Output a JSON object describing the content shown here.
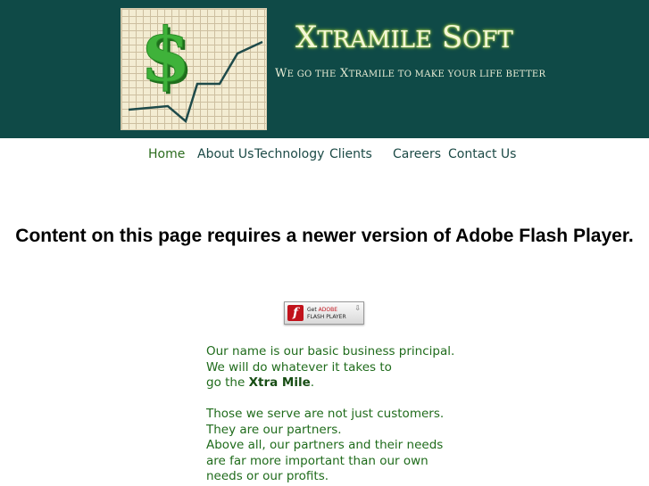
{
  "header": {
    "brand": {
      "x": "X",
      "tramile": "TRAMILE",
      "s": "S",
      "oft": "OFT"
    },
    "tagline": {
      "w": "W",
      "e_go_the": "E GO THE",
      "x": "X",
      "tramile_rest": "TRAMILE TO MAKE YOUR LIFE BETTER"
    },
    "logo_icon": "dollar-sign-growth-chart",
    "colors": {
      "header_bg": "#0f4a47",
      "brand_text": "#f4f7d6",
      "dollar": "#3fb23a"
    }
  },
  "nav": {
    "items": [
      {
        "label": "Home",
        "active": true
      },
      {
        "label": "About Us"
      },
      {
        "label": "Technology"
      },
      {
        "label": "Clients"
      },
      {
        "label": "Careers"
      },
      {
        "label": "Contact Us"
      }
    ]
  },
  "main": {
    "flash_message": "Content on this page requires a newer version of Adobe Flash Player.",
    "flash_badge": {
      "line1_get": "Get",
      "line1_adobe": "ADOBE",
      "line2": "FLASH PLAYER",
      "icon": "flash-player-icon"
    },
    "paragraph1": {
      "line1": "Our name is our basic business principal.",
      "line2": "We will do whatever it takes to",
      "line3_prefix": "go the ",
      "line3_bold": "Xtra Mile",
      "line3_suffix": "."
    },
    "paragraph2": {
      "line1": "Those we serve are not just customers.",
      "line2": "They are our partners.",
      "line3": "Above all, our partners and their needs",
      "line4": "are far more important than our own",
      "line5": "needs or our profits."
    }
  }
}
